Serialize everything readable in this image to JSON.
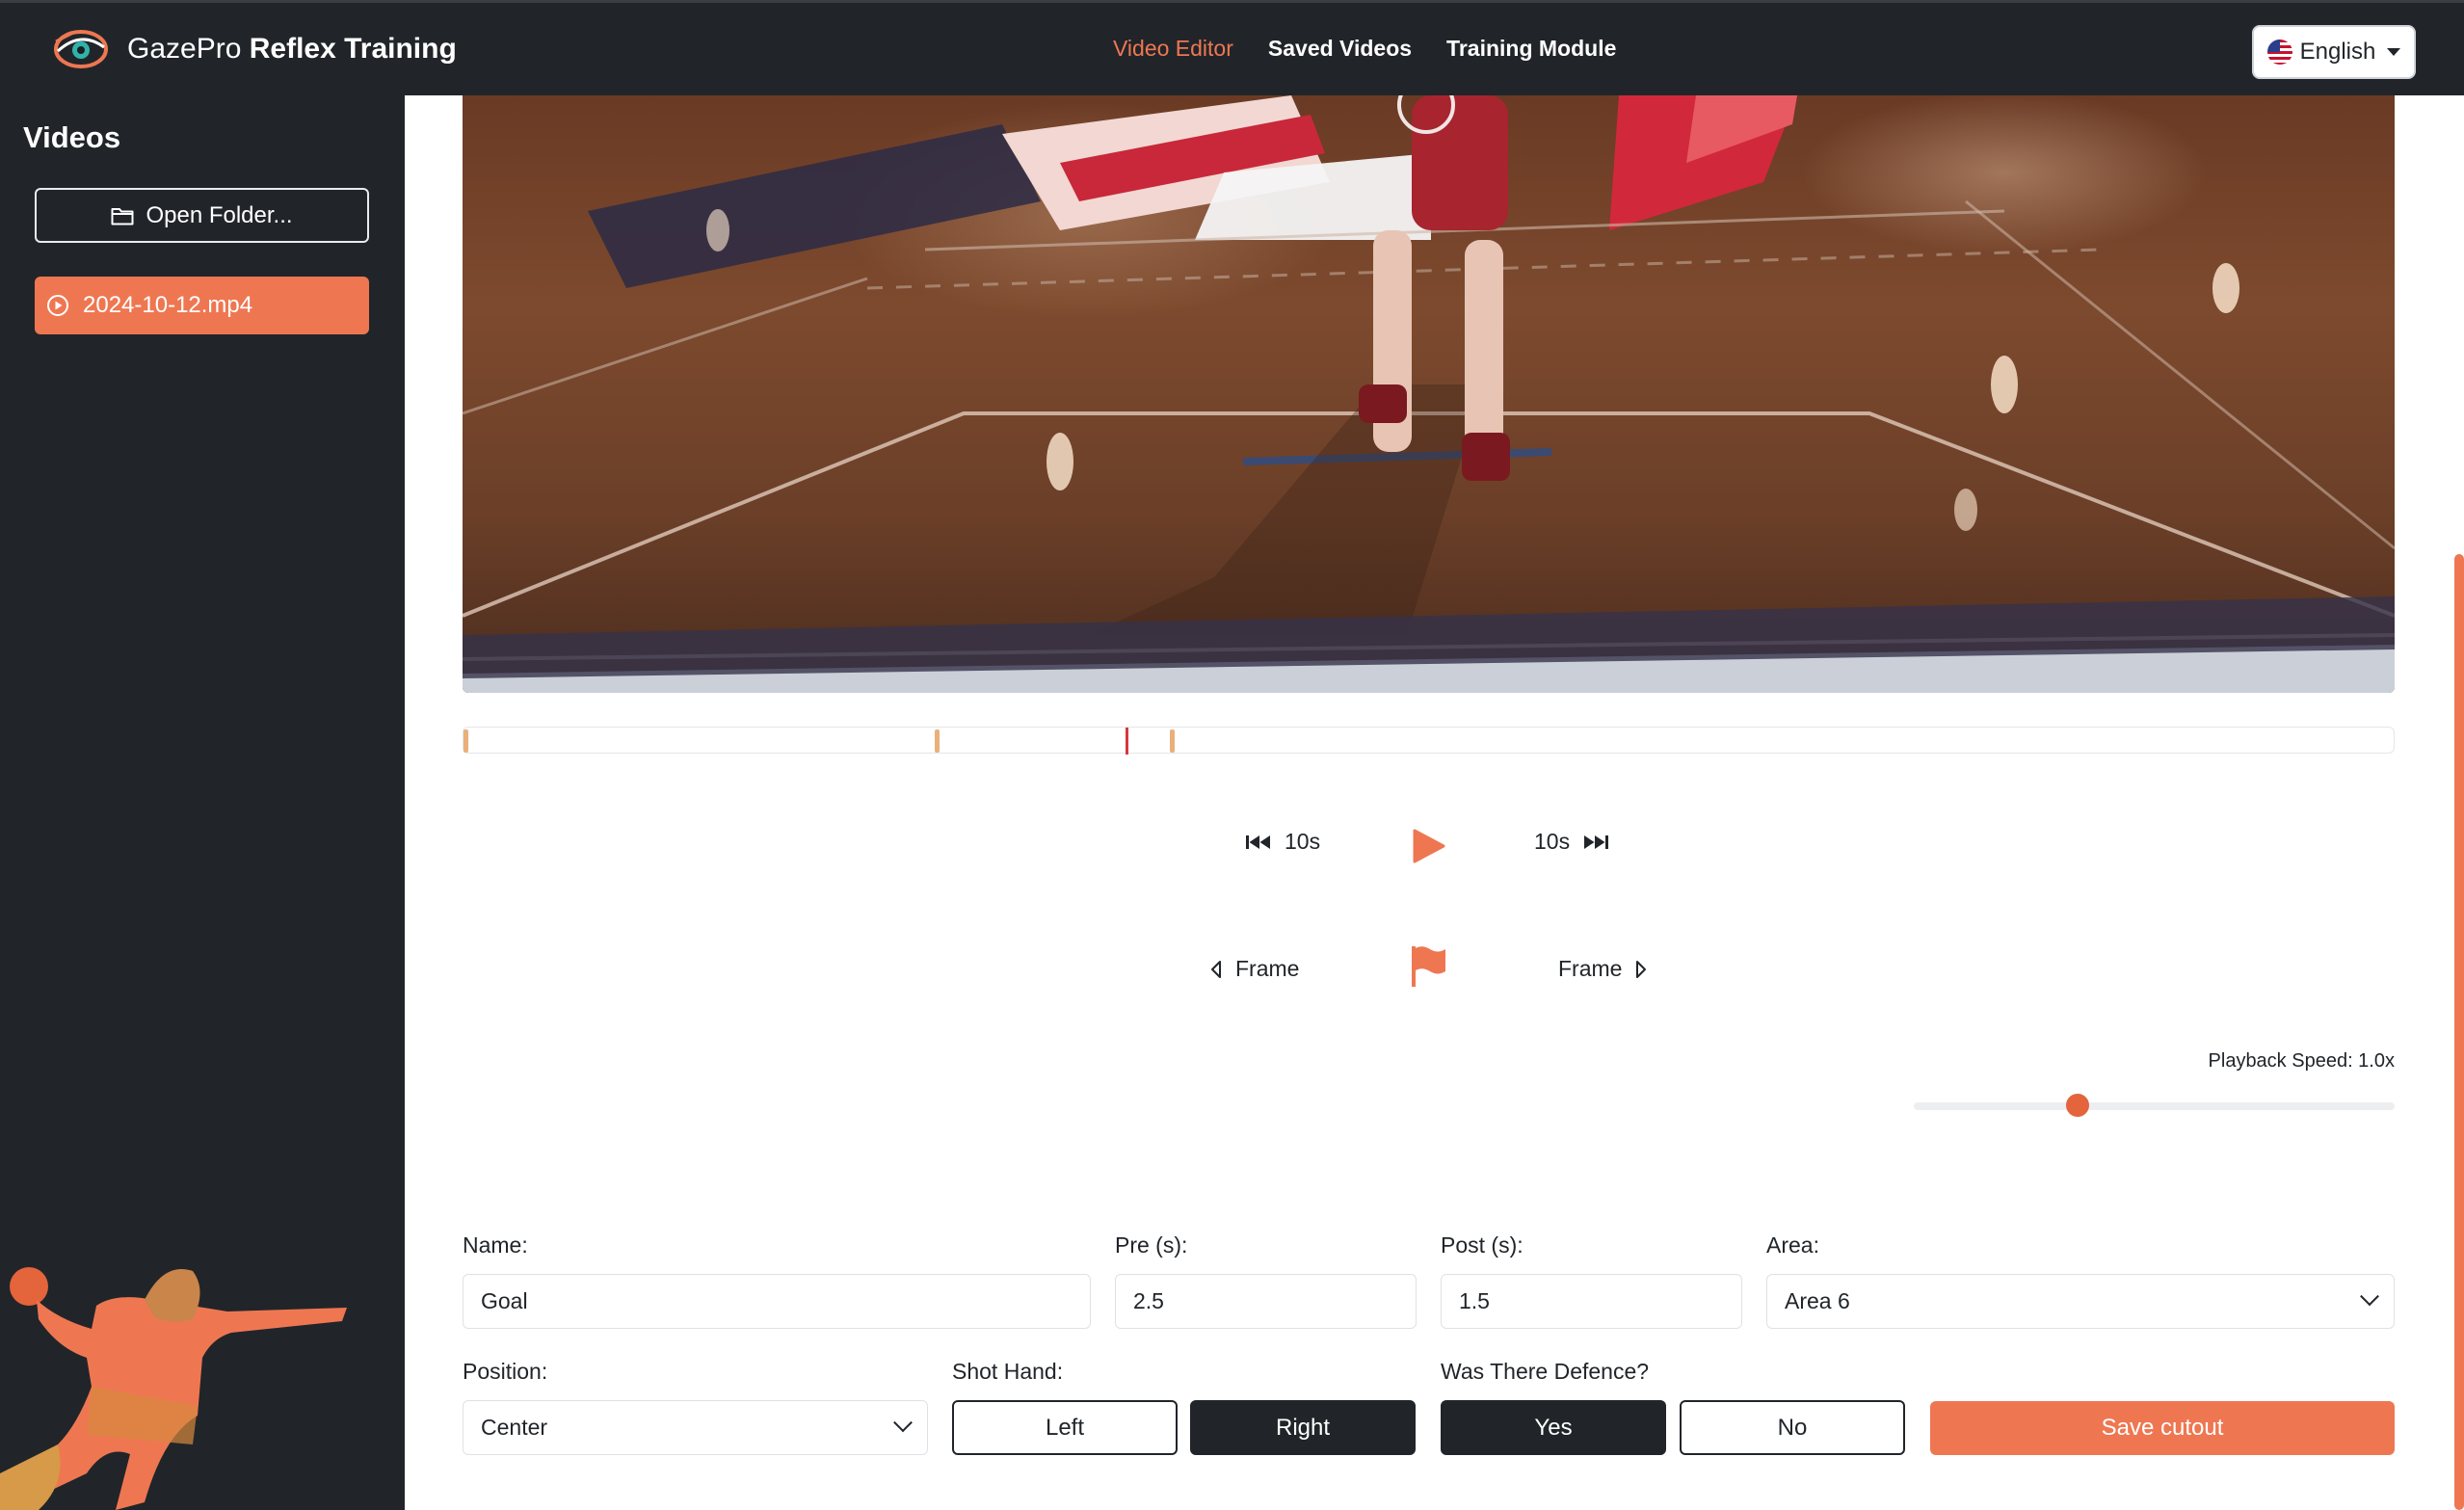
{
  "app": {
    "brand_light": "GazePro",
    "brand_bold": "Reflex Training",
    "accent_color": "#ee7752",
    "dark_color": "#212529"
  },
  "nav": {
    "links": [
      {
        "label": "Video Editor",
        "active": true
      },
      {
        "label": "Saved Videos",
        "active": false
      },
      {
        "label": "Training Module",
        "active": false
      }
    ],
    "language": "English",
    "language_icon": "us-flag-icon"
  },
  "sidebar": {
    "title": "Videos",
    "open_folder_label": "Open Folder...",
    "open_folder_icon": "folder-icon",
    "videos": [
      {
        "label": "2024-10-12.mp4",
        "icon": "play-circle-icon",
        "selected": true
      }
    ]
  },
  "player": {
    "timeline": {
      "markers_fraction": [
        0.0,
        0.245,
        0.367
      ],
      "cursor_fraction": 0.343
    },
    "skip_back_label": "10s",
    "skip_forward_label": "10s",
    "frame_back_label": "Frame",
    "frame_forward_label": "Frame",
    "playback_speed_label": "Playback Speed: 1.0x",
    "speed_fraction": 0.34
  },
  "form": {
    "name_label": "Name:",
    "name_value": "Goal",
    "pre_label": "Pre (s):",
    "pre_value": "2.5",
    "post_label": "Post (s):",
    "post_value": "1.5",
    "area_label": "Area:",
    "area_value": "Area 6",
    "position_label": "Position:",
    "position_value": "Center",
    "shot_hand_label": "Shot Hand:",
    "shot_hand_left": "Left",
    "shot_hand_right": "Right",
    "shot_hand_selected": "Right",
    "defence_label": "Was There Defence?",
    "defence_yes": "Yes",
    "defence_no": "No",
    "defence_selected": "Yes",
    "save_label": "Save cutout"
  }
}
